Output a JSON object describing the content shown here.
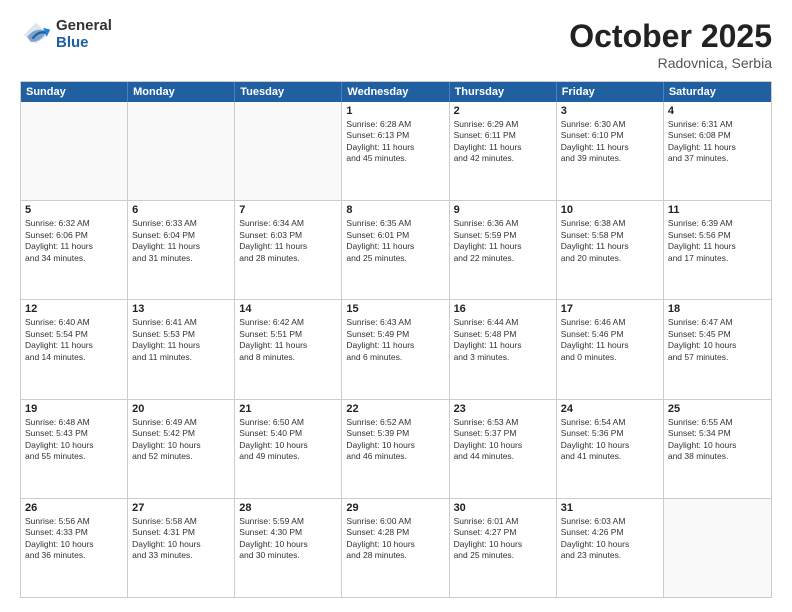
{
  "header": {
    "logo": {
      "general": "General",
      "blue": "Blue"
    },
    "title": "October 2025",
    "location": "Radovnica, Serbia"
  },
  "calendar": {
    "weekdays": [
      "Sunday",
      "Monday",
      "Tuesday",
      "Wednesday",
      "Thursday",
      "Friday",
      "Saturday"
    ],
    "rows": [
      [
        {
          "day": "",
          "info": ""
        },
        {
          "day": "",
          "info": ""
        },
        {
          "day": "",
          "info": ""
        },
        {
          "day": "1",
          "info": "Sunrise: 6:28 AM\nSunset: 6:13 PM\nDaylight: 11 hours\nand 45 minutes."
        },
        {
          "day": "2",
          "info": "Sunrise: 6:29 AM\nSunset: 6:11 PM\nDaylight: 11 hours\nand 42 minutes."
        },
        {
          "day": "3",
          "info": "Sunrise: 6:30 AM\nSunset: 6:10 PM\nDaylight: 11 hours\nand 39 minutes."
        },
        {
          "day": "4",
          "info": "Sunrise: 6:31 AM\nSunset: 6:08 PM\nDaylight: 11 hours\nand 37 minutes."
        }
      ],
      [
        {
          "day": "5",
          "info": "Sunrise: 6:32 AM\nSunset: 6:06 PM\nDaylight: 11 hours\nand 34 minutes."
        },
        {
          "day": "6",
          "info": "Sunrise: 6:33 AM\nSunset: 6:04 PM\nDaylight: 11 hours\nand 31 minutes."
        },
        {
          "day": "7",
          "info": "Sunrise: 6:34 AM\nSunset: 6:03 PM\nDaylight: 11 hours\nand 28 minutes."
        },
        {
          "day": "8",
          "info": "Sunrise: 6:35 AM\nSunset: 6:01 PM\nDaylight: 11 hours\nand 25 minutes."
        },
        {
          "day": "9",
          "info": "Sunrise: 6:36 AM\nSunset: 5:59 PM\nDaylight: 11 hours\nand 22 minutes."
        },
        {
          "day": "10",
          "info": "Sunrise: 6:38 AM\nSunset: 5:58 PM\nDaylight: 11 hours\nand 20 minutes."
        },
        {
          "day": "11",
          "info": "Sunrise: 6:39 AM\nSunset: 5:56 PM\nDaylight: 11 hours\nand 17 minutes."
        }
      ],
      [
        {
          "day": "12",
          "info": "Sunrise: 6:40 AM\nSunset: 5:54 PM\nDaylight: 11 hours\nand 14 minutes."
        },
        {
          "day": "13",
          "info": "Sunrise: 6:41 AM\nSunset: 5:53 PM\nDaylight: 11 hours\nand 11 minutes."
        },
        {
          "day": "14",
          "info": "Sunrise: 6:42 AM\nSunset: 5:51 PM\nDaylight: 11 hours\nand 8 minutes."
        },
        {
          "day": "15",
          "info": "Sunrise: 6:43 AM\nSunset: 5:49 PM\nDaylight: 11 hours\nand 6 minutes."
        },
        {
          "day": "16",
          "info": "Sunrise: 6:44 AM\nSunset: 5:48 PM\nDaylight: 11 hours\nand 3 minutes."
        },
        {
          "day": "17",
          "info": "Sunrise: 6:46 AM\nSunset: 5:46 PM\nDaylight: 11 hours\nand 0 minutes."
        },
        {
          "day": "18",
          "info": "Sunrise: 6:47 AM\nSunset: 5:45 PM\nDaylight: 10 hours\nand 57 minutes."
        }
      ],
      [
        {
          "day": "19",
          "info": "Sunrise: 6:48 AM\nSunset: 5:43 PM\nDaylight: 10 hours\nand 55 minutes."
        },
        {
          "day": "20",
          "info": "Sunrise: 6:49 AM\nSunset: 5:42 PM\nDaylight: 10 hours\nand 52 minutes."
        },
        {
          "day": "21",
          "info": "Sunrise: 6:50 AM\nSunset: 5:40 PM\nDaylight: 10 hours\nand 49 minutes."
        },
        {
          "day": "22",
          "info": "Sunrise: 6:52 AM\nSunset: 5:39 PM\nDaylight: 10 hours\nand 46 minutes."
        },
        {
          "day": "23",
          "info": "Sunrise: 6:53 AM\nSunset: 5:37 PM\nDaylight: 10 hours\nand 44 minutes."
        },
        {
          "day": "24",
          "info": "Sunrise: 6:54 AM\nSunset: 5:36 PM\nDaylight: 10 hours\nand 41 minutes."
        },
        {
          "day": "25",
          "info": "Sunrise: 6:55 AM\nSunset: 5:34 PM\nDaylight: 10 hours\nand 38 minutes."
        }
      ],
      [
        {
          "day": "26",
          "info": "Sunrise: 5:56 AM\nSunset: 4:33 PM\nDaylight: 10 hours\nand 36 minutes."
        },
        {
          "day": "27",
          "info": "Sunrise: 5:58 AM\nSunset: 4:31 PM\nDaylight: 10 hours\nand 33 minutes."
        },
        {
          "day": "28",
          "info": "Sunrise: 5:59 AM\nSunset: 4:30 PM\nDaylight: 10 hours\nand 30 minutes."
        },
        {
          "day": "29",
          "info": "Sunrise: 6:00 AM\nSunset: 4:28 PM\nDaylight: 10 hours\nand 28 minutes."
        },
        {
          "day": "30",
          "info": "Sunrise: 6:01 AM\nSunset: 4:27 PM\nDaylight: 10 hours\nand 25 minutes."
        },
        {
          "day": "31",
          "info": "Sunrise: 6:03 AM\nSunset: 4:26 PM\nDaylight: 10 hours\nand 23 minutes."
        },
        {
          "day": "",
          "info": ""
        }
      ]
    ]
  }
}
